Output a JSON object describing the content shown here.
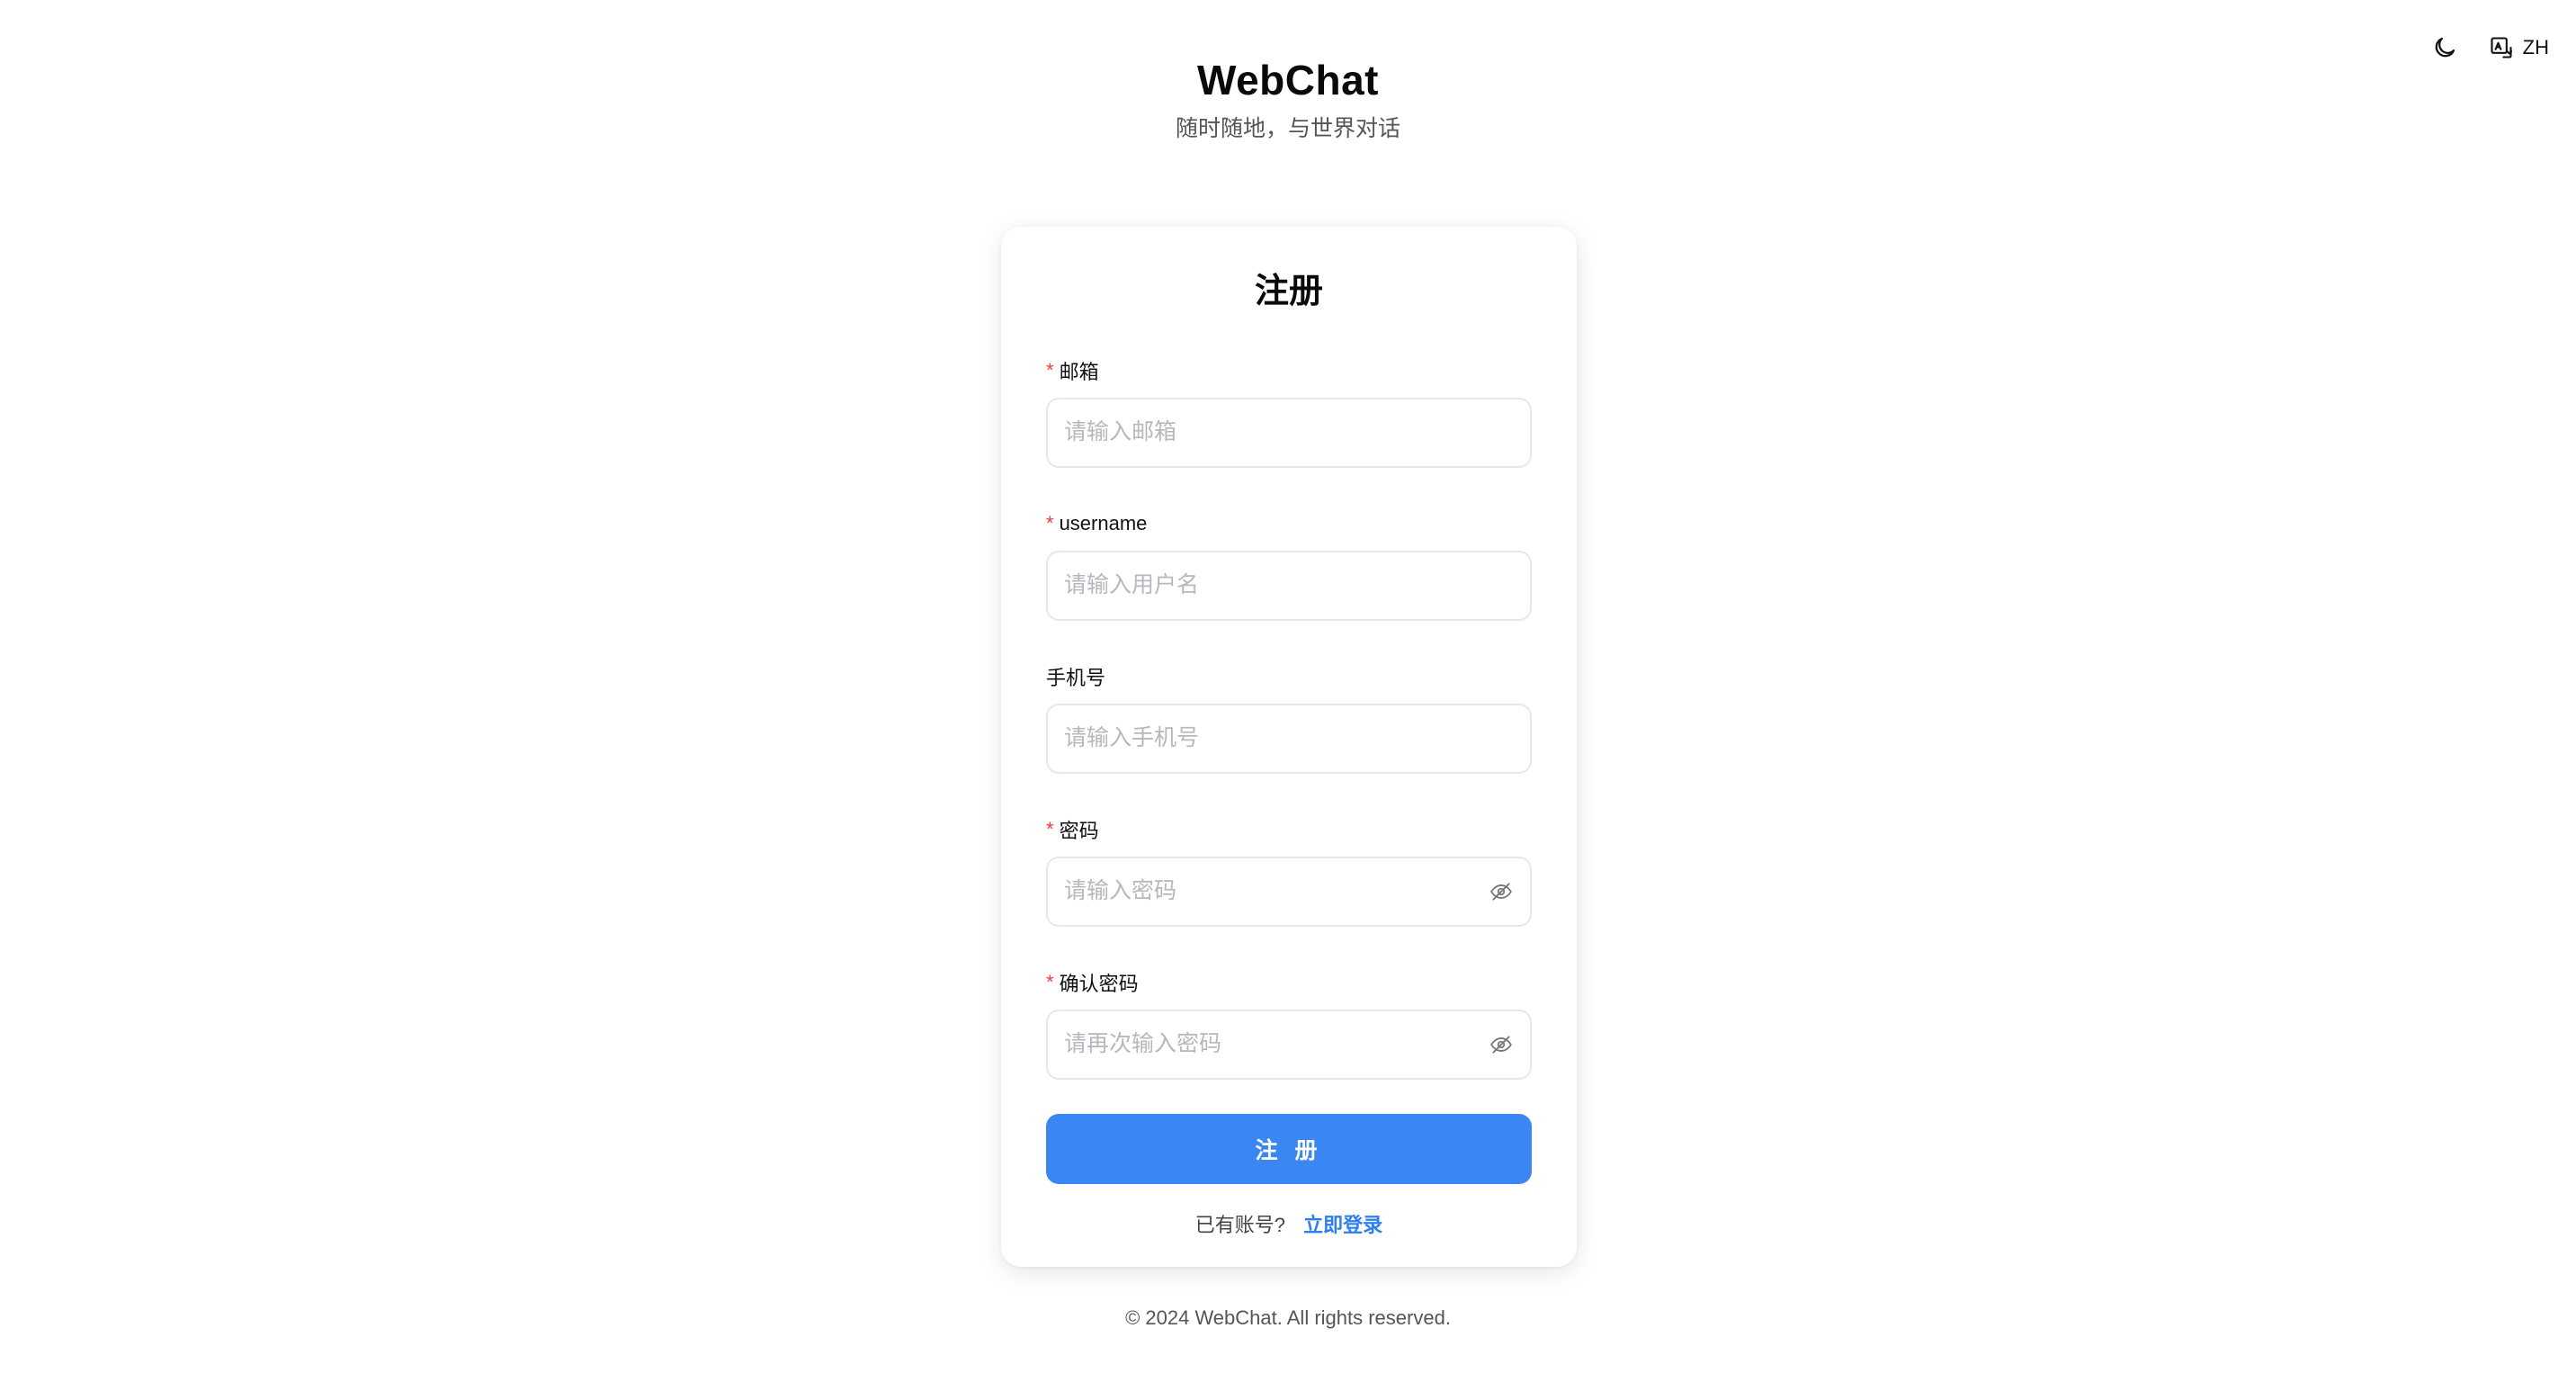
{
  "app": {
    "title": "WebChat",
    "subtitle": "随时随地，与世界对话"
  },
  "topbar": {
    "theme_icon": "moon-icon",
    "language_icon": "language-icon",
    "language_label": "ZH"
  },
  "form": {
    "title": "注册",
    "fields": [
      {
        "label": "邮箱",
        "required": true,
        "placeholder": "请输入邮箱",
        "value": ""
      },
      {
        "label": "username",
        "required": true,
        "placeholder": "请输入用户名",
        "value": ""
      },
      {
        "label": "手机号",
        "required": false,
        "placeholder": "请输入手机号",
        "value": ""
      },
      {
        "label": "密码",
        "required": true,
        "placeholder": "请输入密码",
        "value": "",
        "icon": "eye-off-icon"
      },
      {
        "label": "确认密码",
        "required": true,
        "placeholder": "请再次输入密码",
        "value": "",
        "icon": "eye-off-icon"
      }
    ],
    "required_mark": "*",
    "submit_label": "注 册",
    "login_prompt": "已有账号?",
    "login_link": "立即登录"
  },
  "footer": {
    "copyright": "© 2024 WebChat. All rights reserved."
  },
  "colors": {
    "primary": "#3b86f2",
    "link": "#2d7ff0",
    "required": "#ee3b3b"
  }
}
